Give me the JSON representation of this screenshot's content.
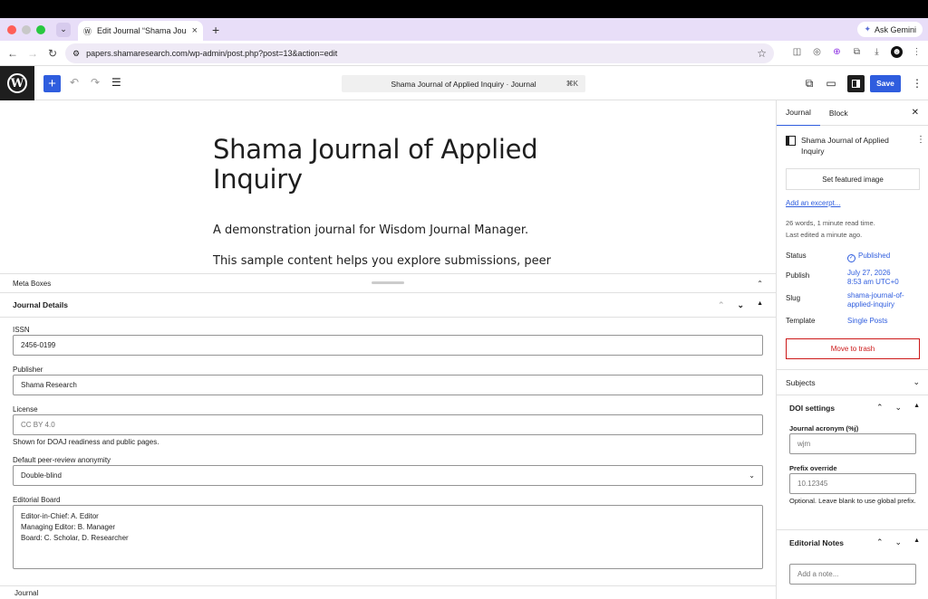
{
  "browser": {
    "tab_title": "Edit Journal “Shama Journal",
    "url": "papers.shamaresearch.com/wp-admin/post.php?post=13&action=edit",
    "ask_gemini": "Ask Gemini"
  },
  "header": {
    "command_center": "Shama Journal of Applied Inquiry · Journal",
    "shortcut": "⌘K",
    "save_label": "Save"
  },
  "post": {
    "title": "Shama Journal of Applied Inquiry",
    "paragraph1": "A demonstration journal for Wisdom Journal Manager.",
    "paragraph2": "This sample content helps you explore submissions, peer review,"
  },
  "meta_boxes": {
    "section_label": "Meta Boxes",
    "panel_title": "Journal Details",
    "issn_label": "ISSN",
    "issn_value": "2456-0199",
    "publisher_label": "Publisher",
    "publisher_value": "Shama Research",
    "license_label": "License",
    "license_placeholder": "CC BY 4.0",
    "license_help": "Shown for DOAJ readiness and public pages.",
    "anonymity_label": "Default peer-review anonymity",
    "anonymity_value": "Double-blind",
    "board_label": "Editorial Board",
    "board_lines": [
      "Editor-in-Chief: A. Editor",
      "Managing Editor: B. Manager",
      "Board: C. Scholar, D. Researcher"
    ]
  },
  "footer": {
    "breadcrumb": "Journal"
  },
  "sidebar": {
    "tab_journal": "Journal",
    "tab_block": "Block",
    "doc_title": "Shama Journal of Applied Inquiry",
    "featured_image": "Set featured image",
    "add_excerpt": "Add an excerpt...",
    "word_count": "26 words, 1 minute read time.",
    "last_edited": "Last edited a minute ago.",
    "status_label": "Status",
    "status_value": "Published",
    "publish_label": "Publish",
    "publish_value_line1": "July 27, 2026",
    "publish_value_line2": "8:53 am UTC+0",
    "slug_label": "Slug",
    "slug_value_line1": "shama-journal-of-",
    "slug_value_line2": "applied-inquiry",
    "template_label": "Template",
    "template_value": "Single Posts",
    "trash": "Move to trash",
    "subjects": "Subjects",
    "doi_title": "DOI settings",
    "acronym_label": "Journal acronym (%j)",
    "acronym_placeholder": "wjm",
    "prefix_label": "Prefix override",
    "prefix_placeholder": "10.12345",
    "prefix_help": "Optional. Leave blank to use global prefix.",
    "notes_title": "Editorial Notes",
    "notes_placeholder": "Add a note..."
  },
  "colors": {
    "accent": "#2f5dde",
    "danger": "#cc1818",
    "tabbar": "#e8def8"
  }
}
